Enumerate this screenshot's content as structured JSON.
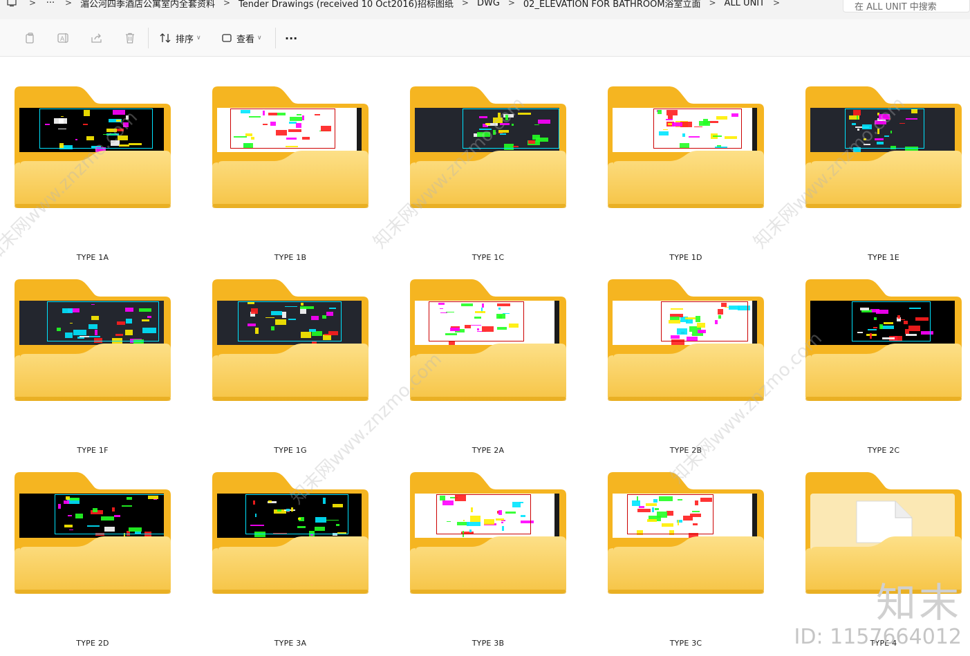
{
  "address_bar": {
    "more": "···",
    "crumbs": [
      "湄公河四季酒店公寓室内全套资料",
      "Tender Drawings (received 10 Oct2016)招标图纸",
      "DWG",
      "02_ELEVATION FOR BATHROOM浴室立面",
      "ALL UNIT"
    ],
    "search_placeholder": "在 ALL UNIT 中搜索"
  },
  "toolbar": {
    "sort_label": "排序",
    "view_label": "查看",
    "more_label": "···"
  },
  "folders": [
    {
      "label": "TYPE 1A",
      "thumb": "dark"
    },
    {
      "label": "TYPE 1B",
      "thumb": "white"
    },
    {
      "label": "TYPE 1C",
      "thumb": "slate"
    },
    {
      "label": "TYPE 1D",
      "thumb": "white"
    },
    {
      "label": "TYPE 1E",
      "thumb": "slate"
    },
    {
      "label": "TYPE 1F",
      "thumb": "slate"
    },
    {
      "label": "TYPE 1G",
      "thumb": "slate"
    },
    {
      "label": "TYPE 2A",
      "thumb": "white"
    },
    {
      "label": "TYPE 2B",
      "thumb": "white"
    },
    {
      "label": "TYPE 2C",
      "thumb": "dark"
    },
    {
      "label": "TYPE 2D",
      "thumb": "dark"
    },
    {
      "label": "TYPE 3A",
      "thumb": "dark"
    },
    {
      "label": "TYPE 3B",
      "thumb": "white"
    },
    {
      "label": "TYPE 3C",
      "thumb": "white"
    },
    {
      "label": "TYPE 4",
      "thumb": "empty"
    }
  ],
  "watermark": {
    "brand": "知末",
    "id_text": "ID: 1157664012",
    "diagonal": "知末网www.znzmo.com"
  },
  "colors": {
    "folder_back": "#f5b521",
    "folder_front_top": "#fde088",
    "folder_front_bottom": "#f6c445",
    "folder_rim": "#e4a716"
  }
}
